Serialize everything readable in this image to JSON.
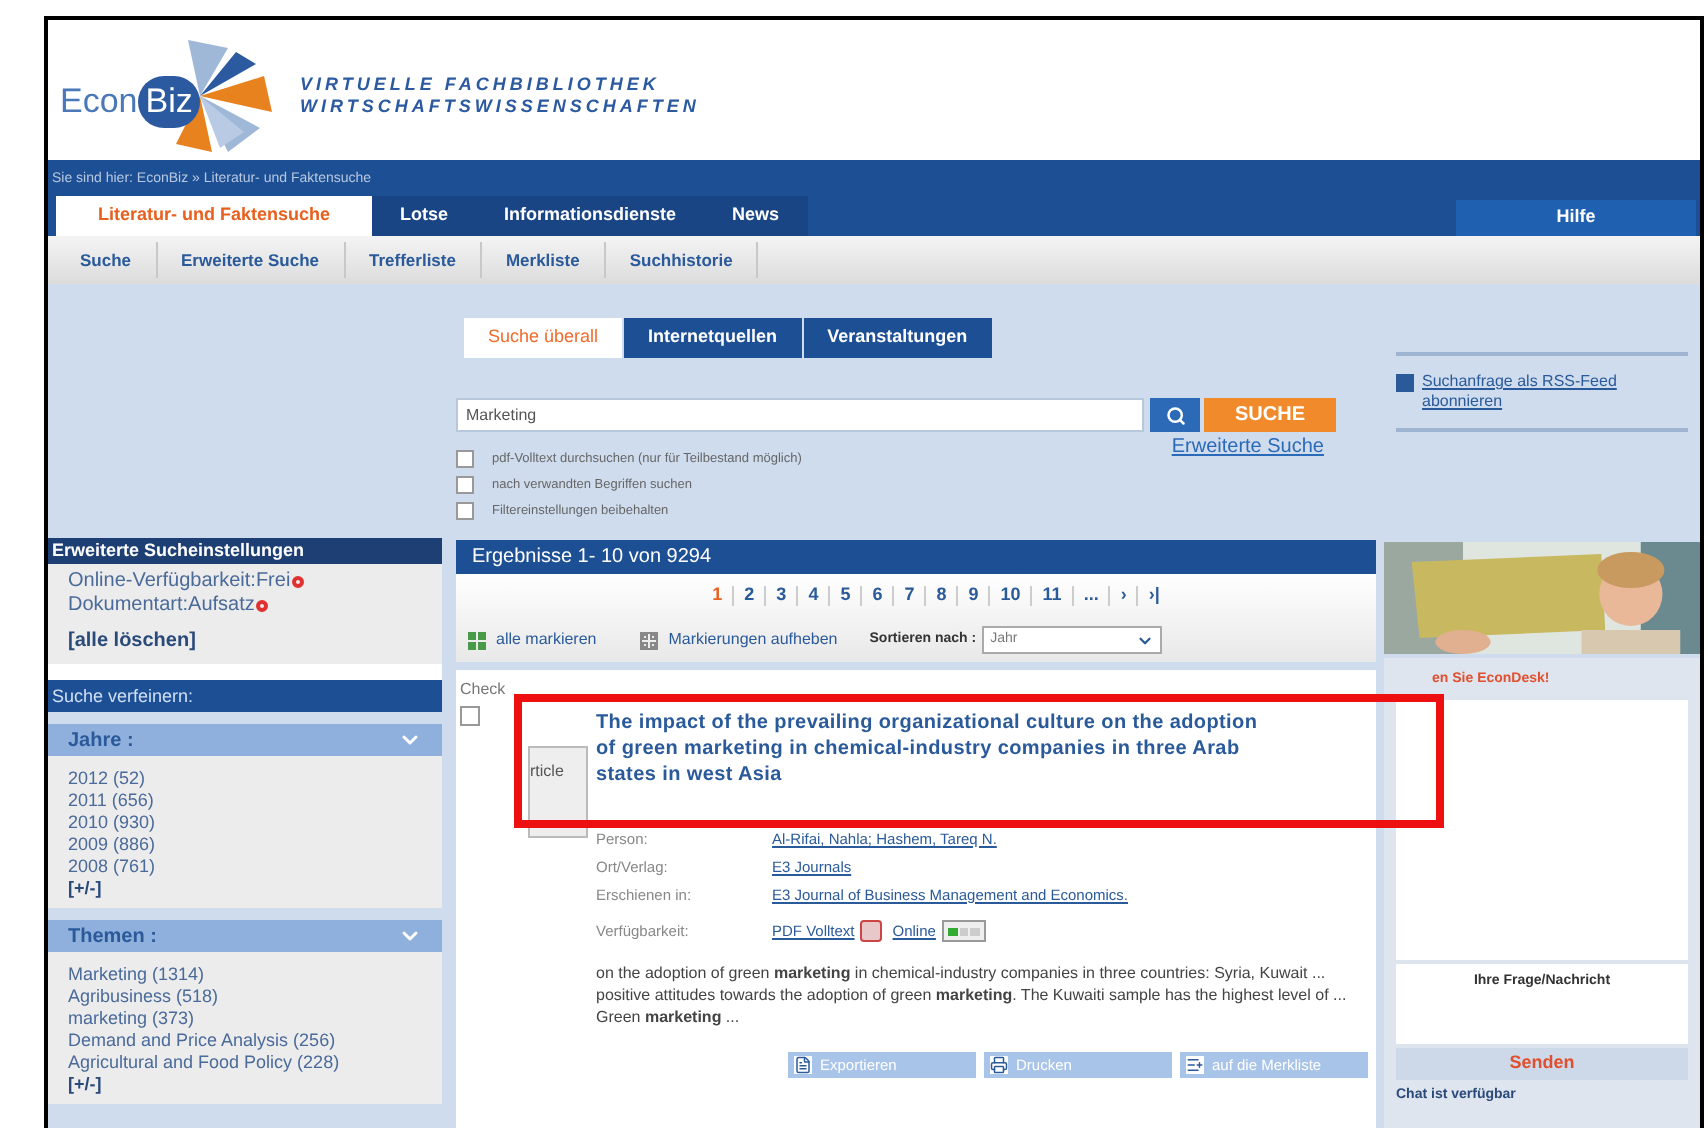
{
  "logo": {
    "part1": "Econ",
    "part2": "Biz",
    "tagline": [
      "VIRTUELLE FACHBIBLIOTHEK",
      "WIRTSCHAFTSWISSENSCHAFTEN"
    ]
  },
  "breadcrumb": "Sie sind hier: EconBiz » Literatur- und Faktensuche",
  "main_tabs": [
    {
      "label": "Literatur- und Faktensuche",
      "selected": true
    },
    {
      "label": "Lotse",
      "selected": false
    },
    {
      "label": "Informationsdienste",
      "selected": false
    },
    {
      "label": "News",
      "selected": false
    }
  ],
  "help_tab": "Hilfe",
  "sub_nav": [
    "Suche",
    "Erweiterte Suche",
    "Trefferliste",
    "Merkliste",
    "Suchhistorie"
  ],
  "sidebar": {
    "settings": {
      "title": "Erweiterte Sucheinstellungen",
      "filters": [
        "Online-Verfügbarkeit:Frei",
        "Dokumentart:Aufsatz"
      ],
      "clear": "[alle löschen]"
    },
    "refine_title": "Suche verfeinern:",
    "facets": [
      {
        "title": "Jahre :",
        "expanded": true,
        "items": [
          "2012 (52)",
          "2011 (656)",
          "2010 (930)",
          "2009 (886)",
          "2008 (761)"
        ],
        "more": "[+/-]"
      },
      {
        "title": "Themen :",
        "expanded": true,
        "items": [
          "Marketing (1314)",
          "Agribusiness (518)",
          "marketing (373)",
          "Demand and Price Analysis (256)",
          "Agricultural and Food Policy (228)"
        ],
        "more": "[+/-]"
      }
    ]
  },
  "search": {
    "tabs": [
      {
        "label": "Suche überall",
        "selected": true
      },
      {
        "label": "Internetquellen",
        "selected": false
      },
      {
        "label": "Veranstaltungen",
        "selected": false
      }
    ],
    "value": "Marketing",
    "button": "SUCHE",
    "advanced_link": "Erweiterte Suche",
    "options": [
      {
        "label": "pdf-Volltext durchsuchen (nur für Teilbestand möglich)",
        "checked": false
      },
      {
        "label": "nach verwandten Begriffen suchen",
        "checked": false
      },
      {
        "label": "Filtereinstellungen beibehalten",
        "checked": false
      }
    ]
  },
  "results": {
    "summary": "Ergebnisse 1- 10 von 9294",
    "pages": [
      {
        "label": "1",
        "selected": true
      },
      {
        "label": "2",
        "selected": false
      },
      {
        "label": "3",
        "selected": false
      },
      {
        "label": "4",
        "selected": false
      },
      {
        "label": "5",
        "selected": false
      },
      {
        "label": "6",
        "selected": false
      },
      {
        "label": "7",
        "selected": false
      },
      {
        "label": "8",
        "selected": false
      },
      {
        "label": "9",
        "selected": false
      },
      {
        "label": "10",
        "selected": false
      },
      {
        "label": "11",
        "selected": false
      },
      {
        "label": "...",
        "selected": false
      },
      {
        "label": "›",
        "selected": false
      },
      {
        "label": "›|",
        "selected": false
      }
    ],
    "mark_all": "alle markieren",
    "unmark": "Markierungen aufheben",
    "sort_label": "Sortieren nach :",
    "sort_value": "Jahr",
    "column_heading": "Check",
    "items": [
      {
        "checked": false,
        "type_label": "rticle",
        "title": "The impact of the prevailing organizational culture on the adoption of green marketing in chemical-industry companies in three Arab states in west Asia",
        "fields": [
          {
            "label": "Person:",
            "value": "Al-Rifai, Nahla; Hashem, Tareq N."
          },
          {
            "label": "Ort/Verlag:",
            "value": "E3 Journals"
          },
          {
            "label": "Erschienen in:",
            "value": "E3 Journal of Business Management and Economics."
          }
        ],
        "availability": {
          "label": "Verfügbarkeit:",
          "pdf": "PDF Volltext",
          "online": "Online"
        },
        "snippet": "on the adoption of green **marketing** in chemical-industry companies in three countries: Syria, Kuwait ... positive attitudes towards the adoption of green **marketing**. The Kuwaiti sample has the highest level of ... Green **marketing** ...",
        "actions": [
          "Exportieren",
          "Drucken",
          "auf die Merkliste"
        ]
      }
    ]
  },
  "right": {
    "rss": "Suchanfrage als RSS-Feed abonnieren",
    "ask": {
      "title": "en Sie EconDesk!",
      "label": "Ihre Frage/Nachricht",
      "button": "Senden",
      "status": "Chat ist verfügbar"
    }
  }
}
